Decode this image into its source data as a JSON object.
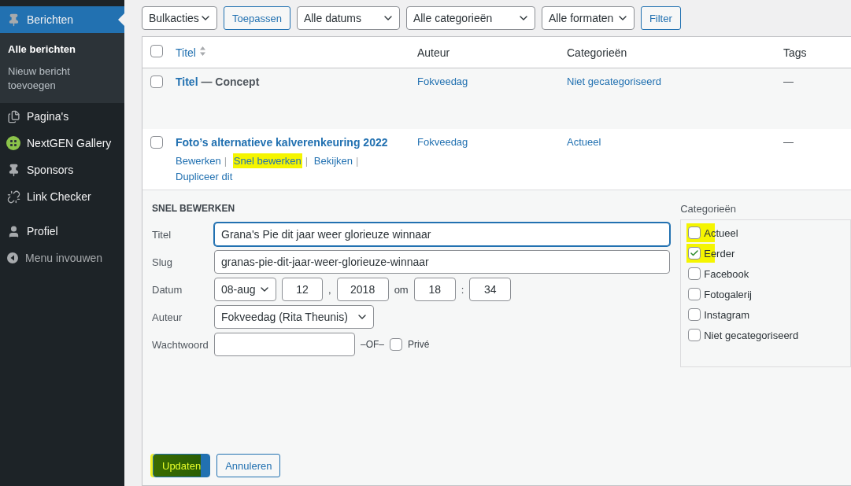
{
  "sidebar": {
    "items": [
      {
        "label": "Berichten",
        "selected": true,
        "children": [
          {
            "label": "Alle berichten",
            "selected": true
          },
          {
            "label": "Nieuw bericht toevoegen",
            "selected": false
          }
        ]
      },
      {
        "label": "Pagina's",
        "selected": false
      },
      {
        "label": "NextGEN Gallery",
        "selected": false
      },
      {
        "label": "Sponsors",
        "selected": false
      },
      {
        "label": "Link Checker",
        "selected": false
      }
    ],
    "footer_items": [
      {
        "label": "Profiel",
        "selected": false
      }
    ],
    "collapse_menu": "Menu invouwen"
  },
  "toolbar": {
    "bulk_actions": "Bulkacties",
    "apply": "Toepassen",
    "filters": [
      "Alle datums",
      "Alle categorieën",
      "Alle formaten"
    ],
    "filter_button": "Filter"
  },
  "table": {
    "select_all_checked": false,
    "columns": [
      "Titel",
      "Auteur",
      "Categorieën",
      "Tags"
    ],
    "rows": [
      {
        "title": "Titel",
        "state": "— Concept",
        "author": "Fokveedag",
        "categories": "Niet gecategoriseerd",
        "tags": "—",
        "checked": false
      },
      {
        "title": "Foto’s alternatieve kalverenkeuring 2022",
        "author": "Fokveedag",
        "categories": "Actueel",
        "tags": "—",
        "checked": false,
        "actions": [
          {
            "label": "Bewerken",
            "separator": "|",
            "highlighted": false
          },
          {
            "label": "Snel bewerken",
            "separator": "|",
            "highlighted": true
          },
          {
            "label": "Bekijken",
            "separator": "|",
            "highlighted": false
          },
          {
            "label": "Dupliceer dit",
            "highlighted": false
          }
        ]
      }
    ]
  },
  "quick_edit": {
    "heading": "SNEL BEWERKEN",
    "title_label": "Titel",
    "title_value": "Grana's Pie dit jaar weer glorieuze winnaar",
    "slug_label": "Slug",
    "slug_value": "granas-pie-dit-jaar-weer-glorieuze-winnaar",
    "date_label": "Datum",
    "month": "08-aug",
    "day": "12",
    "day_sep": ",",
    "year": "2018",
    "at": "om",
    "hour": "18",
    "time_sep": ":",
    "minute": "34",
    "author_label": "Auteur",
    "author_value": "Fokveedag (Rita Theunis)",
    "password_label": "Wachtwoord",
    "or": "–OF–",
    "private_label": "Privé",
    "private_checked": false,
    "categories_heading": "Categorieën",
    "categories": [
      {
        "label": "Actueel",
        "checked": false,
        "highlighted": true
      },
      {
        "label": "Eerder",
        "checked": true,
        "highlighted": true
      },
      {
        "label": "Facebook",
        "checked": false,
        "highlighted": false
      },
      {
        "label": "Fotogalerij",
        "checked": false,
        "highlighted": false
      },
      {
        "label": "Instagram",
        "checked": false,
        "highlighted": false
      },
      {
        "label": "Niet gecategoriseerd",
        "checked": false,
        "highlighted": false
      }
    ],
    "update_button": {
      "label": "Updaten",
      "highlighted": true
    },
    "cancel_button": "Annuleren"
  }
}
